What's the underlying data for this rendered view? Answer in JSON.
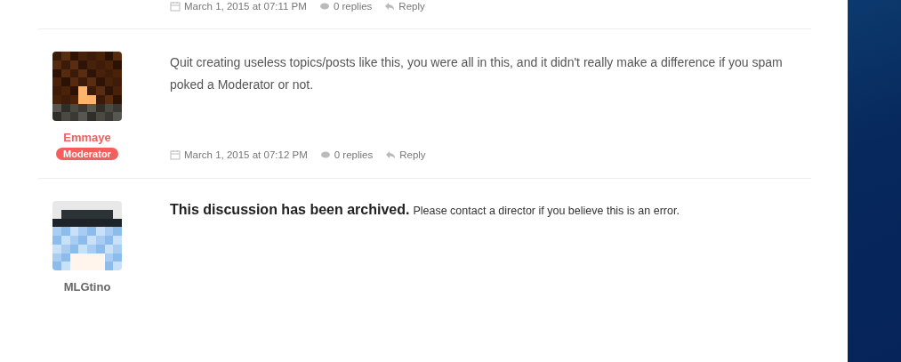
{
  "top_meta": {
    "date": "March 1, 2015 at 07:11 PM",
    "replies": "0 replies",
    "reply": "Reply"
  },
  "posts": [
    {
      "kind": "post",
      "author": "Emmaye",
      "role": "Moderator",
      "text": "Quit creating useless topics/posts like this, you were all in this, and it didn't really make a difference if you spam poked a Moderator or not.",
      "date": "March 1, 2015 at 07:12 PM",
      "replies": "0 replies",
      "reply": "Reply"
    },
    {
      "kind": "notice",
      "author": "MLGtino",
      "title": "This discussion has been archived.",
      "text": "Please contact a director if you believe this is an error."
    }
  ]
}
